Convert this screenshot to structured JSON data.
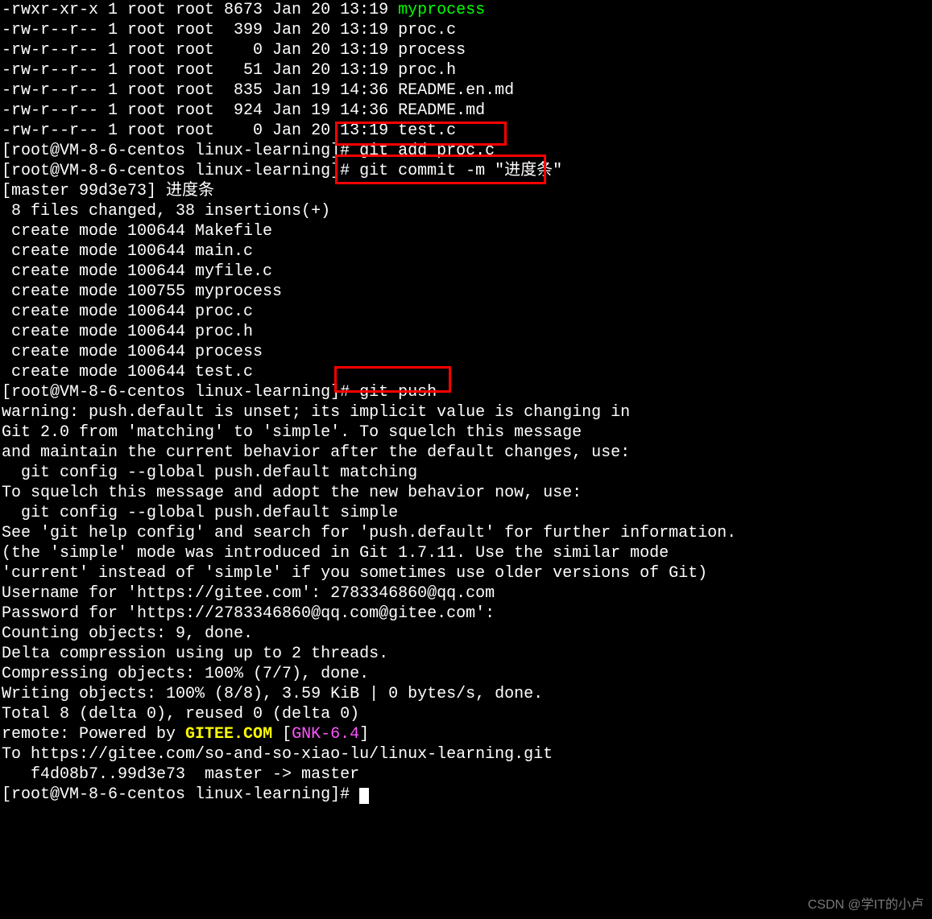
{
  "watermark": "CSDN @学IT的小卢",
  "ls": [
    {
      "perm": "-rwxr-xr-x",
      "n": "1",
      "u": "root",
      "g": "root",
      "size": "8673",
      "date": "Jan 20 13:19",
      "name": "myprocess",
      "cls": "green"
    },
    {
      "perm": "-rw-r--r--",
      "n": "1",
      "u": "root",
      "g": "root",
      "size": " 399",
      "date": "Jan 20 13:19",
      "name": "proc.c",
      "cls": ""
    },
    {
      "perm": "-rw-r--r--",
      "n": "1",
      "u": "root",
      "g": "root",
      "size": "   0",
      "date": "Jan 20 13:19",
      "name": "process",
      "cls": ""
    },
    {
      "perm": "-rw-r--r--",
      "n": "1",
      "u": "root",
      "g": "root",
      "size": "  51",
      "date": "Jan 20 13:19",
      "name": "proc.h",
      "cls": ""
    },
    {
      "perm": "-rw-r--r--",
      "n": "1",
      "u": "root",
      "g": "root",
      "size": " 835",
      "date": "Jan 19 14:36",
      "name": "README.en.md",
      "cls": ""
    },
    {
      "perm": "-rw-r--r--",
      "n": "1",
      "u": "root",
      "g": "root",
      "size": " 924",
      "date": "Jan 19 14:36",
      "name": "README.md",
      "cls": ""
    },
    {
      "perm": "-rw-r--r--",
      "n": "1",
      "u": "root",
      "g": "root",
      "size": "   0",
      "date": "Jan 20 13:19",
      "name": "test.c",
      "cls": ""
    }
  ],
  "prompt": "[root@VM-8-6-centos linux-learning]# ",
  "cmd_add": "git add proc.c",
  "cmd_commit": "git commit -m \"进度条\"",
  "commit_out": [
    "[master 99d3e73] 进度条",
    " 8 files changed, 38 insertions(+)",
    " create mode 100644 Makefile",
    " create mode 100644 main.c",
    " create mode 100644 myfile.c",
    " create mode 100755 myprocess",
    " create mode 100644 proc.c",
    " create mode 100644 proc.h",
    " create mode 100644 process",
    " create mode 100644 test.c"
  ],
  "cmd_push": "git push",
  "push_out": [
    "warning: push.default is unset; its implicit value is changing in",
    "Git 2.0 from 'matching' to 'simple'. To squelch this message",
    "and maintain the current behavior after the default changes, use:",
    "",
    "  git config --global push.default matching",
    "",
    "To squelch this message and adopt the new behavior now, use:",
    "",
    "  git config --global push.default simple",
    "",
    "See 'git help config' and search for 'push.default' for further information.",
    "(the 'simple' mode was introduced in Git 1.7.11. Use the similar mode",
    "'current' instead of 'simple' if you sometimes use older versions of Git)",
    "",
    "Username for 'https://gitee.com': 2783346860@qq.com",
    "Password for 'https://2783346860@qq.com@gitee.com':",
    "Counting objects: 9, done.",
    "Delta compression using up to 2 threads.",
    "Compressing objects: 100% (7/7), done.",
    "Writing objects: 100% (8/8), 3.59 KiB | 0 bytes/s, done.",
    "Total 8 (delta 0), reused 0 (delta 0)"
  ],
  "remote_pre": "remote: Powered by ",
  "remote_gitee": "GITEE.COM",
  "remote_br_open": " [",
  "remote_gnk": "GNK-6.4",
  "remote_br_close": "]",
  "push_tail": [
    "To https://gitee.com/so-and-so-xiao-lu/linux-learning.git",
    "   f4d08b7..99d3e73  master -> master"
  ]
}
